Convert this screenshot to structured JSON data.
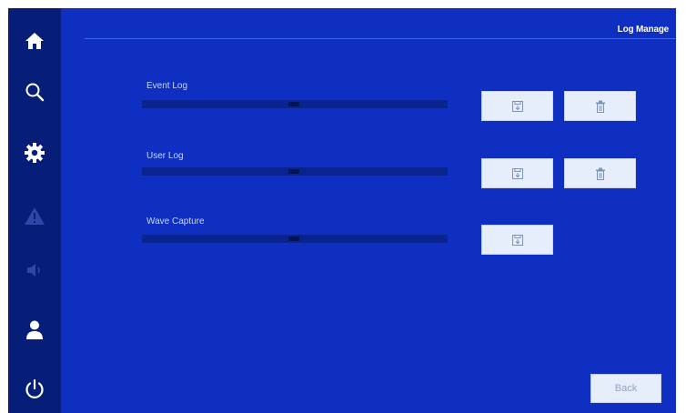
{
  "header": {
    "title": "Log Manage"
  },
  "sidebar": {
    "items": [
      {
        "icon": "home-icon"
      },
      {
        "icon": "search-icon"
      },
      {
        "icon": "gear-icon"
      },
      {
        "icon": "warning-icon"
      },
      {
        "icon": "speaker-icon"
      },
      {
        "icon": "user-icon"
      },
      {
        "icon": "power-icon"
      }
    ]
  },
  "logs": [
    {
      "label": "Event Log",
      "actions": [
        "save-icon",
        "trash-icon"
      ]
    },
    {
      "label": "User Log",
      "actions": [
        "save-icon",
        "trash-icon"
      ]
    },
    {
      "label": "Wave Capture",
      "actions": [
        "save-icon"
      ]
    }
  ],
  "footer": {
    "back_label": "Back"
  },
  "colors": {
    "sidebar": "#061e78",
    "main": "#0e2fc2",
    "button": "#e6eefc",
    "label": "#c9d6ff"
  }
}
